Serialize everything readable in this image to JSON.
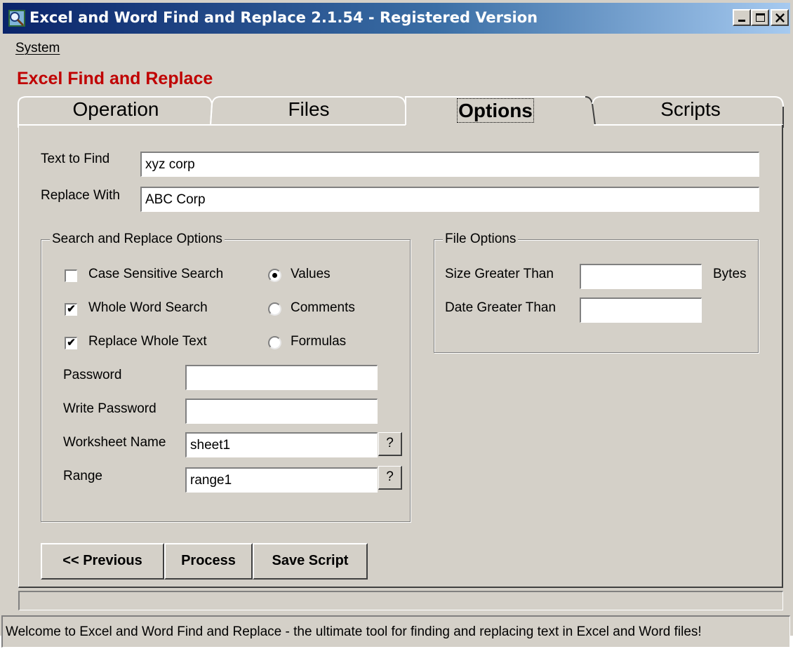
{
  "window": {
    "title": "Excel and Word Find and Replace 2.1.54 - Registered Version",
    "controls": [
      "minimize-icon",
      "maximize-icon",
      "close-icon"
    ]
  },
  "menu": {
    "system_label": "System"
  },
  "section_title": "Excel Find and Replace",
  "tabs": [
    {
      "label": "Operation",
      "active": false
    },
    {
      "label": "Files",
      "active": false
    },
    {
      "label": "Options",
      "active": true
    },
    {
      "label": "Scripts",
      "active": false
    }
  ],
  "options": {
    "text_to_find_label": "Text to Find",
    "text_to_find_value": "xyz corp",
    "replace_with_label": "Replace With",
    "replace_with_value": "ABC Corp",
    "search_group": {
      "caption": "Search and Replace Options",
      "case_sensitive": {
        "label": "Case Sensitive Search",
        "checked": false
      },
      "whole_word": {
        "label": "Whole Word Search",
        "checked": true
      },
      "replace_whole": {
        "label": "Replace Whole Text",
        "checked": true
      },
      "radio_values": {
        "label": "Values",
        "selected": true
      },
      "radio_comments": {
        "label": "Comments",
        "selected": false
      },
      "radio_formulas": {
        "label": "Formulas",
        "selected": false
      },
      "password_label": "Password",
      "password_value": "",
      "write_password_label": "Write Password",
      "write_password_value": "",
      "worksheet_label": "Worksheet Name",
      "worksheet_value": "sheet1",
      "range_label": "Range",
      "range_value": "range1",
      "help_label": "?"
    },
    "file_group": {
      "caption": "File Options",
      "size_label": "Size Greater Than",
      "size_value": "",
      "bytes_label": "Bytes",
      "date_label": "Date Greater Than",
      "date_value": ""
    }
  },
  "buttons": {
    "previous": "<< Previous",
    "process": "Process",
    "save_script": "Save Script"
  },
  "status": "Welcome to Excel and Word Find and Replace - the ultimate tool for finding and replacing text in Excel and Word files!"
}
